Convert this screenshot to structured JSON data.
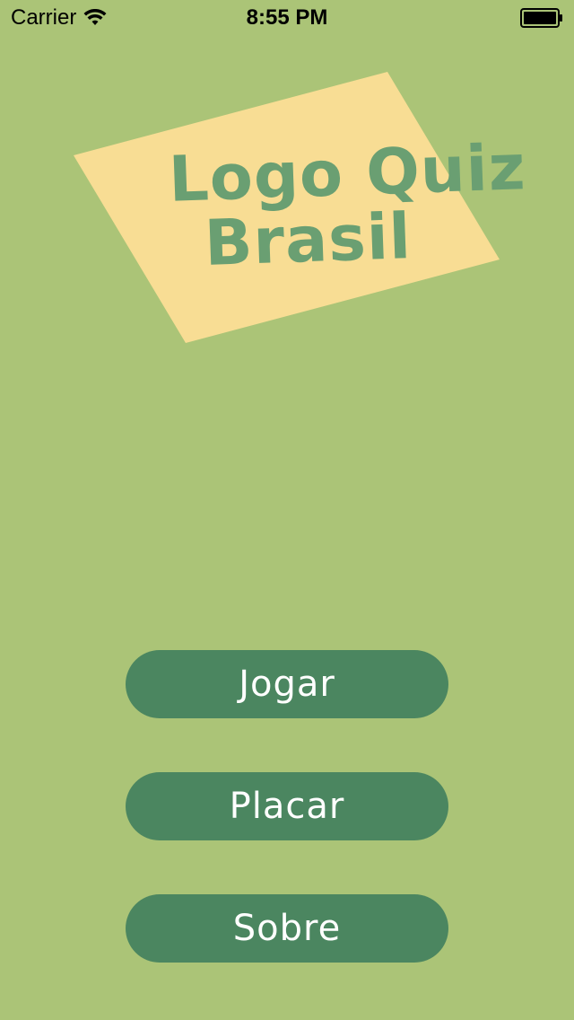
{
  "status_bar": {
    "carrier": "Carrier",
    "time": "8:55 PM",
    "icons": [
      "wifi-icon",
      "battery-icon"
    ]
  },
  "logo": {
    "line1": "Logo Quiz",
    "line2": "Brasil",
    "card_color": "#f8dd94",
    "text_color": "#6a9f72"
  },
  "menu": {
    "play_label": "Jogar",
    "score_label": "Placar",
    "about_label": "Sobre"
  },
  "colors": {
    "background": "#abc477",
    "button": "#4b8660",
    "button_text": "#ffffff"
  }
}
